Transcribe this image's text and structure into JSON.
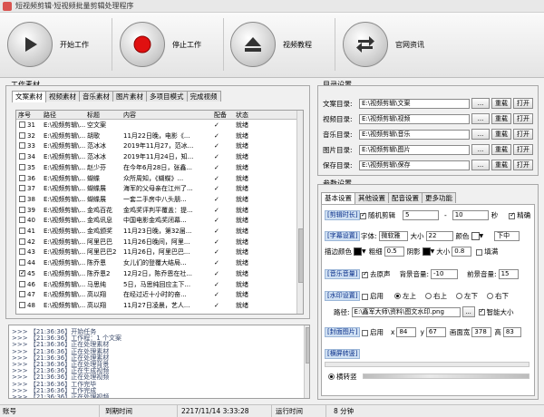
{
  "window": {
    "title": "短视频剪辑·短视频批量剪辑处理程序"
  },
  "toolbar": {
    "start_label": "开始工作",
    "stop_label": "停止工作",
    "tutorial_label": "视频教程",
    "website_label": "官网资讯"
  },
  "material": {
    "group_title": "工作素材",
    "tabs": [
      "文案素材",
      "视频素材",
      "音乐素材",
      "图片素材",
      "多项目模式",
      "完成视频"
    ],
    "columns": [
      "序号",
      "路径",
      "标题",
      "内容",
      "配备",
      "状态"
    ],
    "rows": [
      {
        "checked": false,
        "num": "31",
        "path": "E:\\视频剪辑\\...",
        "title": "空文案",
        "content": "",
        "match": "✓",
        "status": "就绪"
      },
      {
        "checked": false,
        "num": "32",
        "path": "E:\\视频剪辑\\...",
        "title": "胡歌",
        "content": "11月22日晚，电影《...",
        "match": "✓",
        "status": "就绪"
      },
      {
        "checked": false,
        "num": "33",
        "path": "E:\\视频剪辑\\...",
        "title": "范冰冰",
        "content": "2019年11月27，范冰...",
        "match": "✓",
        "status": "就绪"
      },
      {
        "checked": false,
        "num": "34",
        "path": "E:\\视频剪辑\\...",
        "title": "范冰冰",
        "content": "2019年11月24日，知...",
        "match": "✓",
        "status": "就绪"
      },
      {
        "checked": false,
        "num": "35",
        "path": "E:\\视频剪辑\\...",
        "title": "赵少芬",
        "content": "在今年6月28日，张鑫...",
        "match": "✓",
        "status": "就绪"
      },
      {
        "checked": false,
        "num": "36",
        "path": "E:\\视频剪辑\\...",
        "title": "蝴蝶",
        "content": "众所周知，《蝴蝶》...",
        "match": "✓",
        "status": "就绪"
      },
      {
        "checked": false,
        "num": "37",
        "path": "E:\\视频剪辑\\...",
        "title": "蝴蝶展",
        "content": "海军的父母亲在江州了...",
        "match": "✓",
        "status": "就绪"
      },
      {
        "checked": false,
        "num": "38",
        "path": "E:\\视频剪辑\\...",
        "title": "蝴蝶展",
        "content": "一套二手房中八头朋...",
        "match": "✓",
        "status": "就绪"
      },
      {
        "checked": false,
        "num": "39",
        "path": "E:\\视频剪辑\\...",
        "title": "金鸡百花",
        "content": "金鸡奖评判平覆盖：提...",
        "match": "✓",
        "status": "就绪"
      },
      {
        "checked": false,
        "num": "40",
        "path": "E:\\视频剪辑\\...",
        "title": "金鸡讯息",
        "content": "中国电影金鸡奖闭幕...",
        "match": "✓",
        "status": "就绪"
      },
      {
        "checked": false,
        "num": "41",
        "path": "E:\\视频剪辑\\...",
        "title": "金鸡颁奖",
        "content": "11月23日晚，第32届...",
        "match": "✓",
        "status": "就绪"
      },
      {
        "checked": false,
        "num": "42",
        "path": "E:\\视频剪辑\\...",
        "title": "阿里巴巴",
        "content": "11月26日晚间，阿里...",
        "match": "✓",
        "status": "就绪"
      },
      {
        "checked": false,
        "num": "43",
        "path": "E:\\视频剪辑\\...",
        "title": "阿里巴巴2",
        "content": "11月26日，阿里巴巴...",
        "match": "✓",
        "status": "就绪"
      },
      {
        "checked": false,
        "num": "44",
        "path": "E:\\视频剪辑\\...",
        "title": "陈乔恩",
        "content": "女儿们的登覆大结局...",
        "match": "✓",
        "status": "就绪"
      },
      {
        "checked": true,
        "num": "45",
        "path": "E:\\视频剪辑\\...",
        "title": "陈乔恩2",
        "content": "12月2日，陈乔恩在社...",
        "match": "✓",
        "status": "就绪"
      },
      {
        "checked": false,
        "num": "46",
        "path": "E:\\视频剪辑\\...",
        "title": "马思纯",
        "content": "5日，马思纯回应主下...",
        "match": "✓",
        "status": "就绪"
      },
      {
        "checked": false,
        "num": "47",
        "path": "E:\\视频剪辑\\...",
        "title": "高以翔",
        "content": "在经过近十小时的奋...",
        "match": "✓",
        "status": "就绪"
      },
      {
        "checked": false,
        "num": "48",
        "path": "E:\\视频剪辑\\...",
        "title": "高以翔",
        "content": "11月27日凌晨，艺人...",
        "match": "✓",
        "status": "就绪"
      }
    ]
  },
  "log": {
    "lines": [
      ">>> 【21:36:36】开始任务",
      ">>> 【21:36:36】工作程：1 个文案",
      ">>> 【21:36:36】正在处理素材",
      ">>> 【21:36:36】正在处理素材",
      ">>> 【21:36:36】正在处理素材",
      ">>> 【21:36:36】正在处理背景",
      ">>> 【21:36:36】正在生成视频",
      ">>> 【21:36:36】正在处理视频",
      ">>> 【21:36:36】工作完毕",
      ">>> 【21:36:36】工作完成",
      ">>> 【21:36:36】正在处理视频"
    ]
  },
  "dirs": {
    "group_title": "目录设置",
    "rows": [
      {
        "label": "文案目录:",
        "value": "E:\\视频剪辑\\文案",
        "browse": "...",
        "load": "重载",
        "open": "打开"
      },
      {
        "label": "视频目录:",
        "value": "E:\\视频剪辑\\视频",
        "browse": "...",
        "load": "重载",
        "open": "打开"
      },
      {
        "label": "音乐目录:",
        "value": "E:\\视频剪辑\\音乐",
        "browse": "...",
        "load": "重载",
        "open": "打开"
      },
      {
        "label": "图片目录:",
        "value": "E:\\视频剪辑\\图片",
        "browse": "...",
        "load": "重载",
        "open": "打开"
      },
      {
        "label": "保存目录:",
        "value": "E:\\视频剪辑\\保存",
        "browse": "...",
        "load": "重载",
        "open": "打开"
      }
    ]
  },
  "params": {
    "group_title": "参数设置",
    "tabs": [
      "基本设置",
      "其他设置",
      "配音设置",
      "更多功能"
    ],
    "duration": {
      "section": "[剪辑时长]",
      "random_label": "随机剪辑",
      "min": "5",
      "dash": "-",
      "max": "10",
      "unit": "秒",
      "precise_label": "精确"
    },
    "subtitle": {
      "section": "[字幕设置]",
      "font_label": "字体:",
      "font_value": "微软雅",
      "size_label": "大小",
      "size_value": "22",
      "color_label": "颜色",
      "pos_value": "下中",
      "edge_label": "描边颜色",
      "thick_label": "粗细",
      "thick_value": "0.5",
      "shadow_label": "阴影",
      "shadow_size_label": "大小",
      "shadow_size_value": "0.8",
      "fill_label": "填满"
    },
    "music": {
      "section": "[音乐音量]",
      "remove_label": "去原声",
      "bg_label": "背景音量:",
      "bg_value": "-10",
      "fg_label": "前景音量:",
      "fg_value": "15"
    },
    "watermark": {
      "section": "[水印设置]",
      "enable_label": "启用",
      "pos_options": [
        "左上",
        "右上",
        "左下",
        "右下"
      ],
      "path_label": "路径:",
      "path_value": "E:\\鑫军大师\\资料\\图文水印.png",
      "browse": "...",
      "smart_label": "智能大小"
    },
    "cover": {
      "section": "[封面图片]",
      "enable_label": "启用",
      "x_label": "x",
      "x_value": "84",
      "y_label": "y",
      "y_value": "67",
      "w_label": "画面宽",
      "w_value": "378",
      "h_label": "高",
      "h_value": "83"
    },
    "bar": {
      "section": "[横屏转竖]",
      "option_label": "横转竖"
    }
  },
  "statusbar": {
    "account": "账号",
    "expire_label": "到期时间",
    "expire_value": "2217/11/14 3:33:28",
    "runtime_label": "运行时间",
    "runtime_value": "8 分钟"
  },
  "colors": {
    "section_bg": "#cfe0f3",
    "section_text": "#0a2f8a",
    "stop_red": "#e01010"
  }
}
